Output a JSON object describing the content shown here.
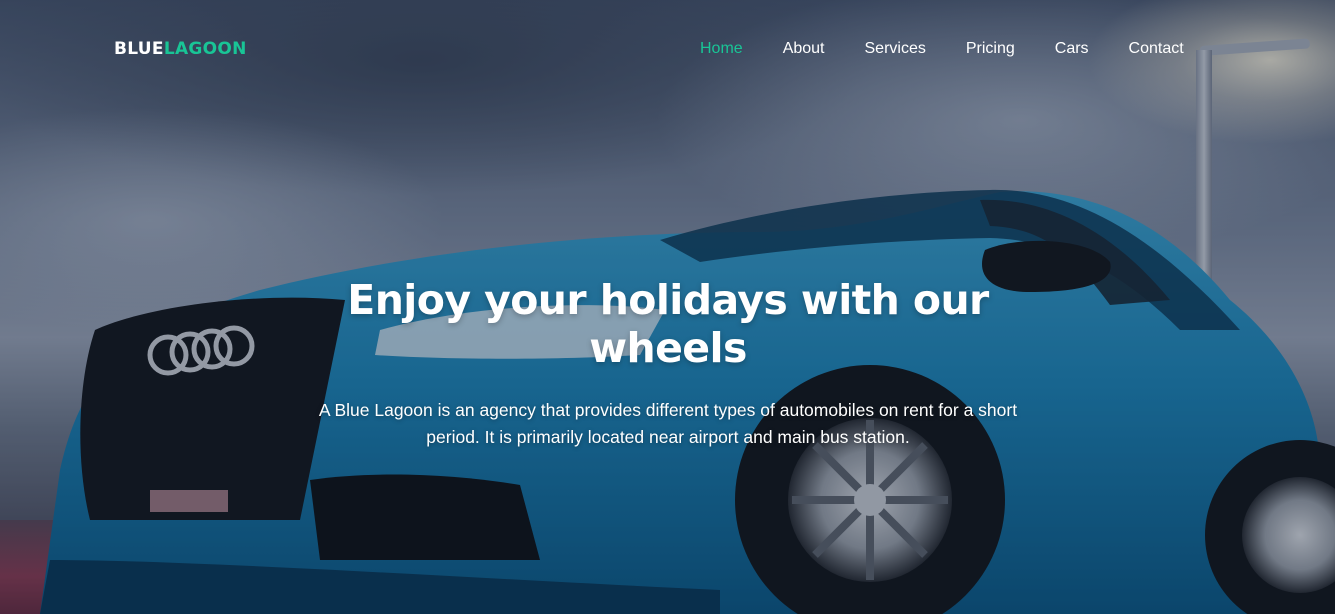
{
  "brand": {
    "part1": "BLUE",
    "part2": "LAGOON",
    "accent_color": "#19c596"
  },
  "nav": {
    "items": [
      {
        "label": "Home",
        "active": true
      },
      {
        "label": "About",
        "active": false
      },
      {
        "label": "Services",
        "active": false
      },
      {
        "label": "Pricing",
        "active": false
      },
      {
        "label": "Cars",
        "active": false
      },
      {
        "label": "Contact",
        "active": false
      }
    ]
  },
  "hero": {
    "headline": "Enjoy your holidays with our wheels",
    "description": "A Blue Lagoon is an agency that provides different types of automobiles on rent for a short period. It is primarily located near airport and main bus station.",
    "background_subject": "blue-sports-car"
  }
}
